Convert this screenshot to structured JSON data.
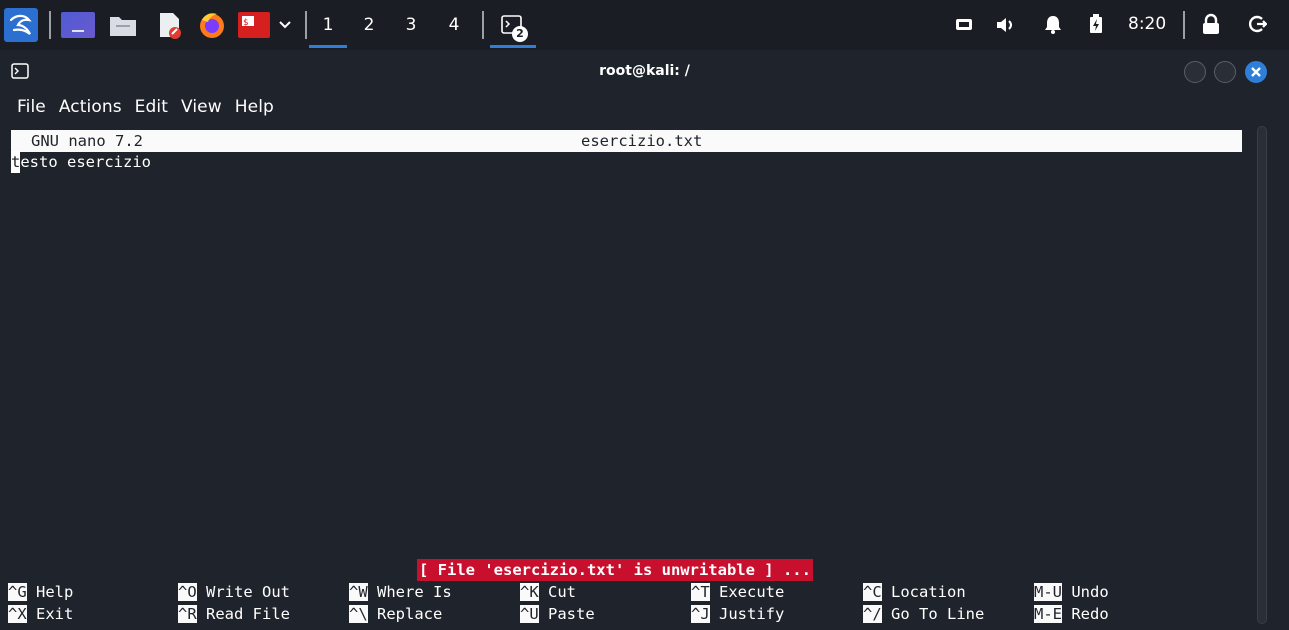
{
  "panel": {
    "workspaces": [
      "1",
      "2",
      "3",
      "4"
    ],
    "active_workspace": "1",
    "terminal_badge": "2",
    "clock": "8:20"
  },
  "window": {
    "title": "root@kali: /"
  },
  "menu": {
    "items": [
      "File",
      "Actions",
      "Edit",
      "View",
      "Help"
    ]
  },
  "nano": {
    "version": "GNU nano 7.2",
    "filename": "esercizio.txt",
    "cursor_char": "t",
    "content_rest": "esto esercizio",
    "status": "[ File 'esercizio.txt' is unwritable ] ...",
    "shortcuts_row1": [
      {
        "key": "^G",
        "label": "Help"
      },
      {
        "key": "^O",
        "label": "Write Out"
      },
      {
        "key": "^W",
        "label": "Where Is"
      },
      {
        "key": "^K",
        "label": "Cut"
      },
      {
        "key": "^T",
        "label": "Execute"
      },
      {
        "key": "^C",
        "label": "Location"
      },
      {
        "key": "M-U",
        "label": "Undo"
      }
    ],
    "shortcuts_row2": [
      {
        "key": "^X",
        "label": "Exit"
      },
      {
        "key": "^R",
        "label": "Read File"
      },
      {
        "key": "^\\",
        "label": "Replace"
      },
      {
        "key": "^U",
        "label": "Paste"
      },
      {
        "key": "^J",
        "label": "Justify"
      },
      {
        "key": "^/",
        "label": "Go To Line"
      },
      {
        "key": "M-E",
        "label": "Redo"
      }
    ]
  },
  "colors": {
    "panel_bg": "#1a1d23",
    "window_bg": "#1f232b",
    "accent_blue": "#2f7fd8",
    "status_red": "#c8102e",
    "header_bg": "#fafafa"
  }
}
